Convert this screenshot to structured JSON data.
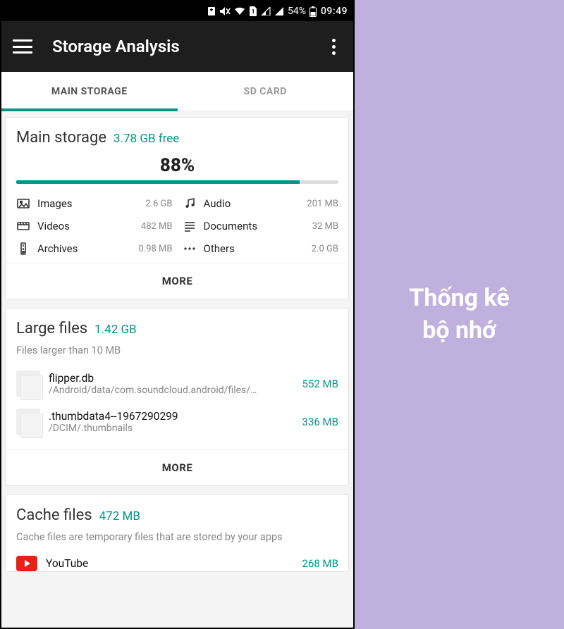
{
  "status": {
    "battery": "54%",
    "time": "09:49"
  },
  "appbar": {
    "title": "Storage Analysis"
  },
  "tabs": {
    "main": "MAIN STORAGE",
    "sd": "SD CARD"
  },
  "main_storage": {
    "title": "Main storage",
    "free": "3.78 GB free",
    "percent_label": "88%",
    "percent_value": 88,
    "categories": [
      {
        "icon": "image",
        "label": "Images",
        "size": "2.6 GB"
      },
      {
        "icon": "audio",
        "label": "Audio",
        "size": "201 MB"
      },
      {
        "icon": "video",
        "label": "Videos",
        "size": "482 MB"
      },
      {
        "icon": "document",
        "label": "Documents",
        "size": "32 MB"
      },
      {
        "icon": "archive",
        "label": "Archives",
        "size": "0.98 MB"
      },
      {
        "icon": "others",
        "label": "Others",
        "size": "2.0 GB"
      }
    ],
    "more": "MORE"
  },
  "large_files": {
    "title": "Large files",
    "total": "1.42 GB",
    "note": "Files larger than 10 MB",
    "files": [
      {
        "name": "flipper.db",
        "path": "/Android/data/com.soundcloud.android/files/…",
        "size": "552 MB"
      },
      {
        "name": ".thumbdata4--1967290299",
        "path": "/DCIM/.thumbnails",
        "size": "336 MB"
      }
    ],
    "more": "MORE"
  },
  "cache_files": {
    "title": "Cache files",
    "total": "472 MB",
    "note": "Cache files are temporary files that are stored by your apps",
    "apps": [
      {
        "name": "YouTube",
        "size": "268 MB"
      }
    ]
  },
  "side_caption": "Thống kê\nbộ nhớ"
}
